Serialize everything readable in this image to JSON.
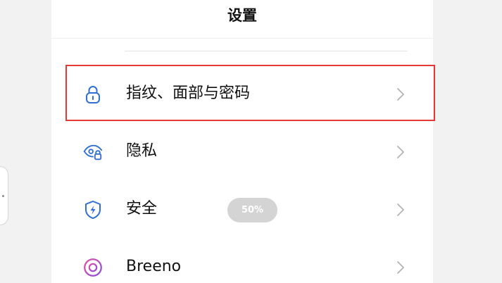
{
  "header": {
    "title": "设置"
  },
  "settings": {
    "items": [
      {
        "label": "指纹、面部与密码",
        "icon": "lock-icon"
      },
      {
        "label": "隐私",
        "icon": "privacy-eye-icon"
      },
      {
        "label": "安全",
        "icon": "shield-bolt-icon",
        "badge": "50%"
      },
      {
        "label": "Breeno",
        "icon": "breeno-ring-icon"
      }
    ]
  },
  "colors": {
    "accent": "#2f6fd6",
    "highlight": "#e53935",
    "badge_bg": "#d4d4d4",
    "breeno_gradient": [
      "#e14fa6",
      "#8a4fe0"
    ]
  }
}
